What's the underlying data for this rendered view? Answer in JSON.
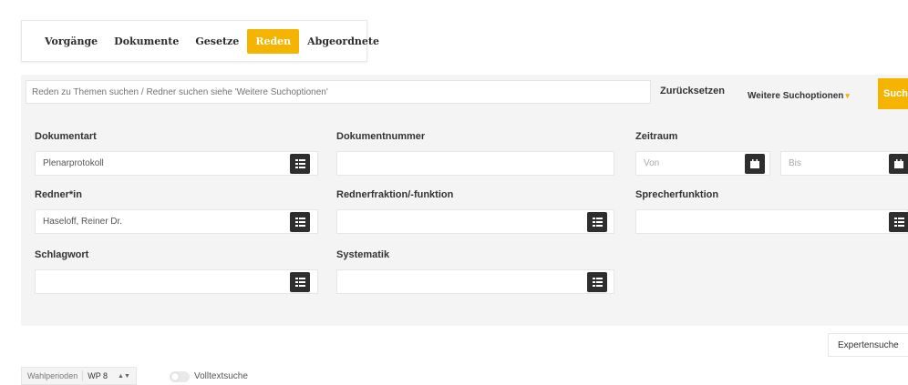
{
  "tabs": [
    {
      "label": "Vorgänge",
      "active": false
    },
    {
      "label": "Dokumente",
      "active": false
    },
    {
      "label": "Gesetze",
      "active": false
    },
    {
      "label": "Reden",
      "active": true
    },
    {
      "label": "Abgeordnete",
      "active": false
    }
  ],
  "search": {
    "placeholder": "Reden zu Themen suchen / Redner suchen siehe 'Weitere Suchoptionen'",
    "reset_label": "Zurücksetzen",
    "more_options_label": "Weitere Suchoptionen",
    "submit_label": "Such"
  },
  "filters": {
    "dokumentart": {
      "label": "Dokumentart",
      "value": "Plenarprotokoll"
    },
    "dokumentnummer": {
      "label": "Dokumentnummer",
      "value": ""
    },
    "zeitraum": {
      "label": "Zeitraum",
      "from_placeholder": "Von",
      "to_placeholder": "Bis"
    },
    "redner": {
      "label": "Redner*in",
      "value": "Haseloff, Reiner Dr."
    },
    "rednerfraktion": {
      "label": "Rednerfraktion/-funktion",
      "value": ""
    },
    "sprecherfunktion": {
      "label": "Sprecherfunktion",
      "value": ""
    },
    "schlagwort": {
      "label": "Schlagwort",
      "value": ""
    },
    "systematik": {
      "label": "Systematik",
      "value": ""
    }
  },
  "expert_label": "Expertensuche",
  "bottom": {
    "wahlperioden_label": "Wahlperioden",
    "wp_value": "WP 8",
    "fulltext_label": "Volltextsuche"
  },
  "colors": {
    "accent": "#f5b400",
    "button_dark": "#2e2e2e",
    "panel_bg": "#f4f4f4"
  }
}
